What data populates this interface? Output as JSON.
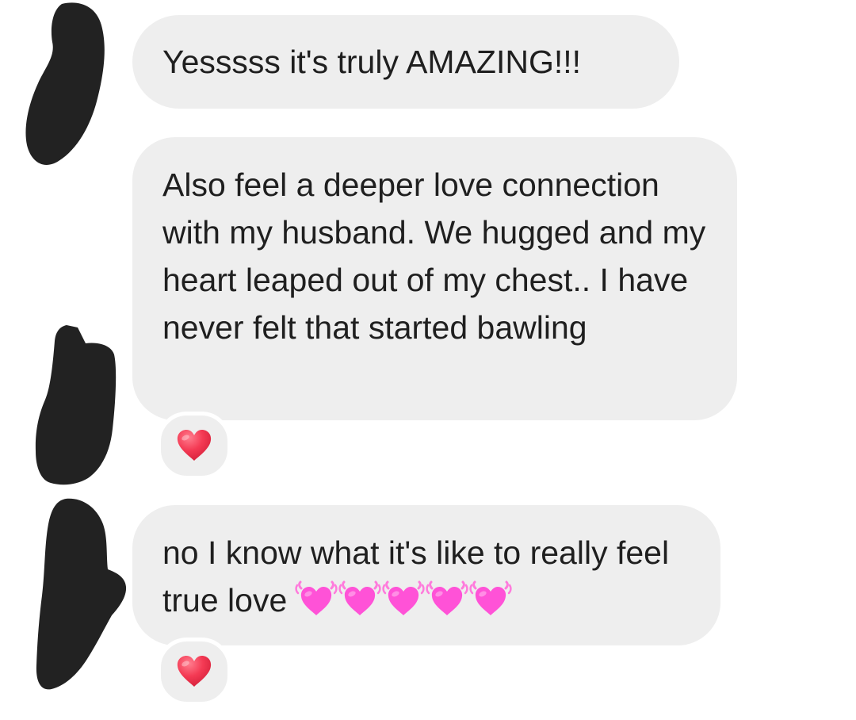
{
  "conversation": {
    "messages": [
      {
        "text": "Yesssss it's truly AMAZING!!!",
        "reaction": null
      },
      {
        "text": "Also feel a deeper love connection with my husband. We hugged and my heart leaped out of my chest.. I have never felt that started bawling",
        "reaction": {
          "icon": "red-heart-icon",
          "color": "#f43a54"
        }
      },
      {
        "text": "no I know what it's like to really feel true love",
        "inline_emoji": {
          "icon": "beating-heart-icon",
          "count": 5,
          "color": "#ff52d7"
        },
        "reaction": {
          "icon": "red-heart-icon",
          "color": "#f43a54"
        }
      }
    ]
  },
  "theme": {
    "bubble_color": "#eeeeee",
    "text_color": "#1f1f1f",
    "redaction_color": "#222222",
    "background": "#ffffff"
  }
}
